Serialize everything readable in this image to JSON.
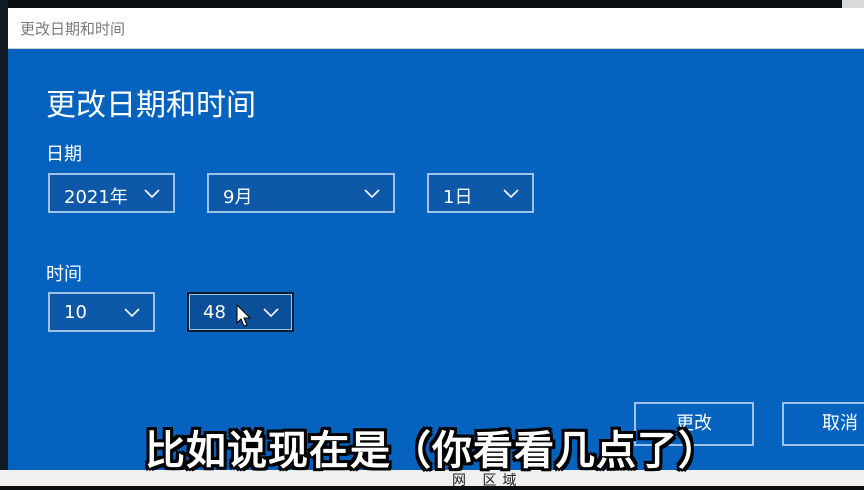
{
  "window": {
    "title": "更改日期和时间"
  },
  "dialog": {
    "heading": "更改日期和时间",
    "date_label": "日期",
    "time_label": "时间",
    "date": {
      "year": "2021年",
      "month": "9月",
      "day": "1日"
    },
    "time": {
      "hour": "10",
      "minute": "48"
    },
    "buttons": {
      "change": "更改",
      "cancel": "取消"
    }
  },
  "background": {
    "bottom_fragment": "网 区域"
  },
  "subtitle": "比如说现在是（你看看几点了）",
  "colors": {
    "dialog_bg": "#0563bf",
    "dropdown_border": "#9ec3e8",
    "text": "#ffffff"
  },
  "icons": {
    "dropdown": "chevron-down-icon",
    "cursor": "mouse-pointer-icon"
  }
}
